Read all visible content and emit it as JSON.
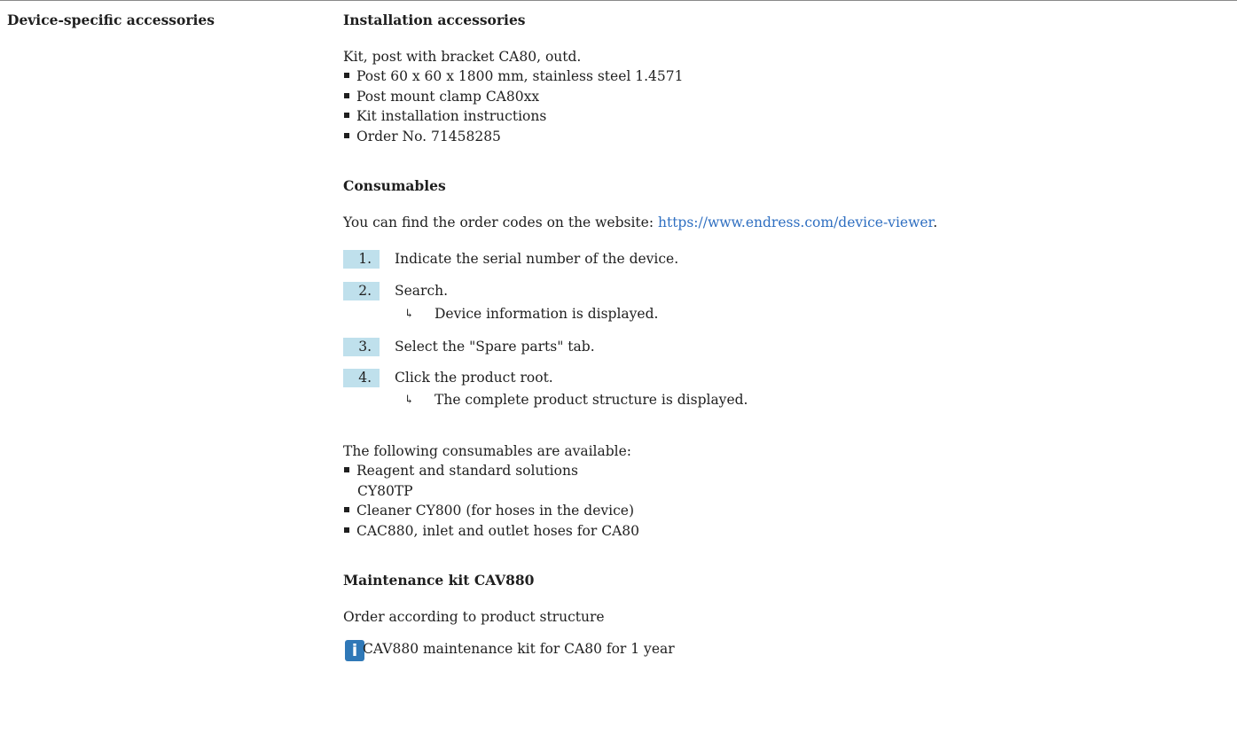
{
  "side_heading": "Device-specific accessories",
  "installation": {
    "heading": "Installation accessories",
    "kit_title": "Kit, post with bracket CA80, outd.",
    "items": [
      "Post 60 x 60 x 1800 mm, stainless steel 1.4571",
      "Post mount clamp CA80xx",
      "Kit installation instructions",
      "Order No. 71458285"
    ]
  },
  "consumables": {
    "heading": "Consumables",
    "intro_prefix": "You can find the order codes on the website: ",
    "link_text": "https://www.endress.com/device-viewer",
    "intro_suffix": ".",
    "steps": [
      {
        "num": "1.",
        "text": "Indicate the serial number of the device."
      },
      {
        "num": "2.",
        "text": "Search.",
        "result": "Device information is displayed."
      },
      {
        "num": "3.",
        "text": "Select the \"Spare parts\" tab."
      },
      {
        "num": "4.",
        "text": "Click the product root.",
        "result": "The complete product structure is displayed."
      }
    ],
    "available_intro": "The following consumables are available:",
    "available_items": [
      {
        "line1": "Reagent and standard solutions",
        "line2": "CY80TP"
      },
      {
        "line1": "Cleaner CY800 (for hoses in the device)"
      },
      {
        "line1": "CAC880, inlet and outlet hoses for CA80"
      }
    ]
  },
  "maintenance": {
    "heading": "Maintenance kit CAV880",
    "text": "Order according to product structure",
    "info_icon_label": "i",
    "note": "CAV880 maintenance kit for CA80 for 1 year"
  },
  "icons": {
    "bullet": "square-bullet-icon",
    "result": "result-arrow-icon",
    "info": "info-icon"
  }
}
